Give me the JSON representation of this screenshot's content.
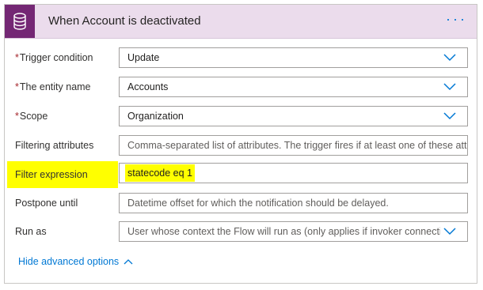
{
  "header": {
    "title": "When Account is deactivated",
    "more_label": "···",
    "icon": "database-icon",
    "color": "#742774"
  },
  "fields": {
    "trigger_condition": {
      "label": "Trigger condition",
      "required": true,
      "value": "Update"
    },
    "entity_name": {
      "label": "The entity name",
      "required": true,
      "value": "Accounts"
    },
    "scope": {
      "label": "Scope",
      "required": true,
      "value": "Organization"
    },
    "filtering_attributes": {
      "label": "Filtering attributes",
      "placeholder": "Comma-separated list of attributes. The trigger fires if at least one of these attri"
    },
    "filter_expression": {
      "label": "Filter expression",
      "value": "statecode eq 1",
      "highlight": "#ffff00"
    },
    "postpone_until": {
      "label": "Postpone until",
      "placeholder": "Datetime offset for which the notification should be delayed."
    },
    "run_as": {
      "label": "Run as",
      "placeholder": "User whose context the Flow will run as (only applies if invoker connectio"
    }
  },
  "advanced": {
    "label": "Hide advanced options",
    "icon": "chevron-up-icon"
  },
  "required_marker": "*"
}
